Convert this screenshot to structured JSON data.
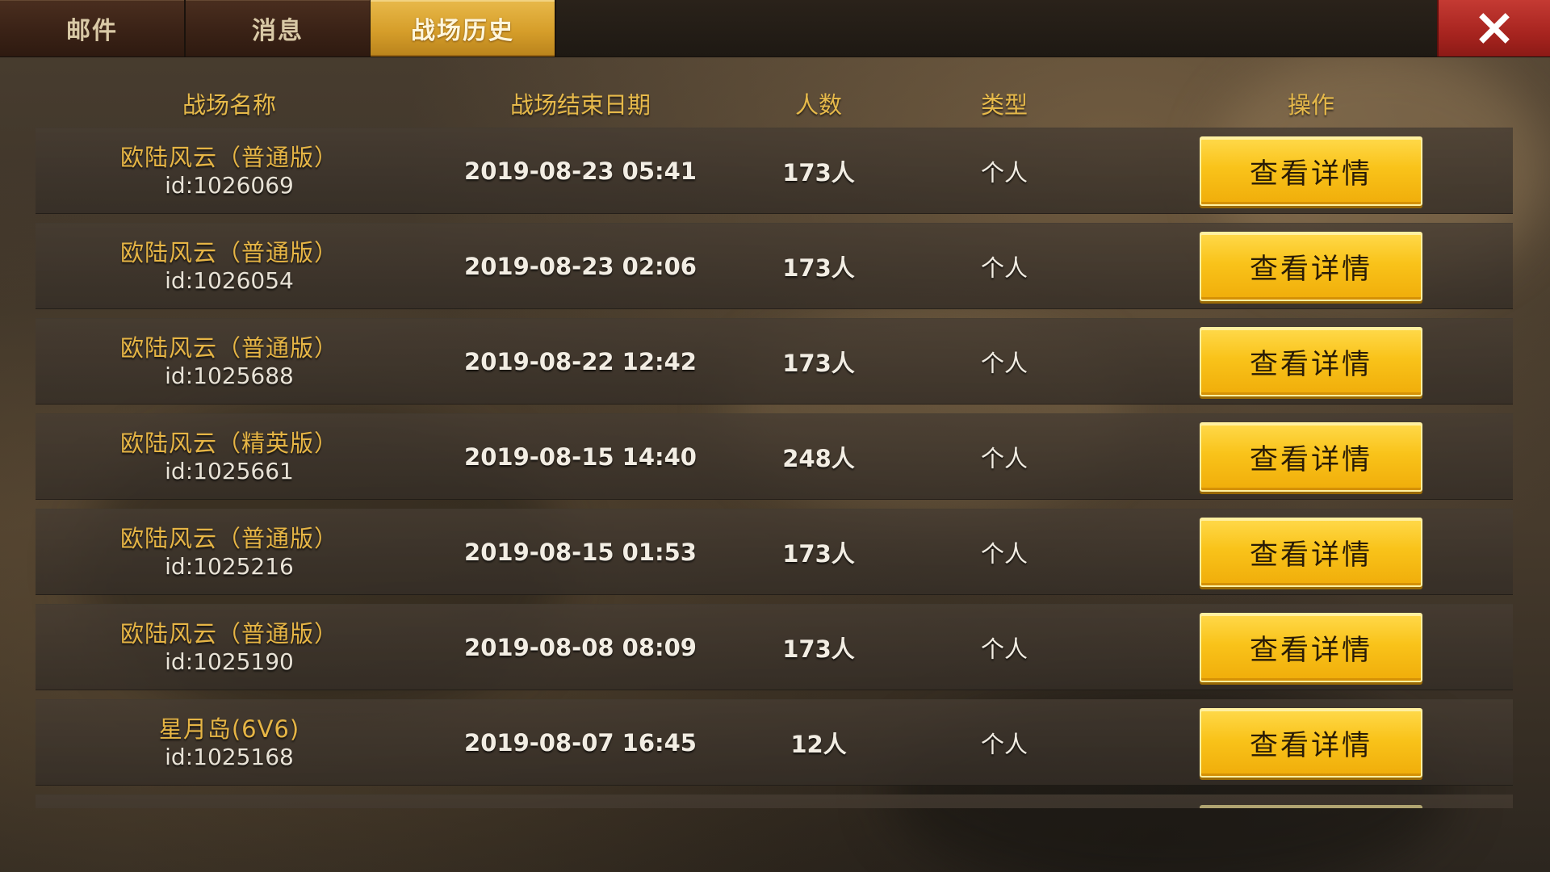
{
  "tabs": [
    {
      "label": "邮件",
      "active": false
    },
    {
      "label": "消息",
      "active": false
    },
    {
      "label": "战场历史",
      "active": true
    }
  ],
  "close_icon": "close-x-icon",
  "table": {
    "headers": {
      "name": "战场名称",
      "date": "战场结束日期",
      "count": "人数",
      "type": "类型",
      "action": "操作"
    },
    "rows": [
      {
        "name": "欧陆风云（普通版）",
        "id": "id:1026069",
        "date": "2019-08-23 05:41",
        "count": "173人",
        "type": "个人",
        "action": "查看详情"
      },
      {
        "name": "欧陆风云（普通版）",
        "id": "id:1026054",
        "date": "2019-08-23 02:06",
        "count": "173人",
        "type": "个人",
        "action": "查看详情"
      },
      {
        "name": "欧陆风云（普通版）",
        "id": "id:1025688",
        "date": "2019-08-22 12:42",
        "count": "173人",
        "type": "个人",
        "action": "查看详情"
      },
      {
        "name": "欧陆风云（精英版）",
        "id": "id:1025661",
        "date": "2019-08-15 14:40",
        "count": "248人",
        "type": "个人",
        "action": "查看详情"
      },
      {
        "name": "欧陆风云（普通版）",
        "id": "id:1025216",
        "date": "2019-08-15 01:53",
        "count": "173人",
        "type": "个人",
        "action": "查看详情"
      },
      {
        "name": "欧陆风云（普通版）",
        "id": "id:1025190",
        "date": "2019-08-08 08:09",
        "count": "173人",
        "type": "个人",
        "action": "查看详情"
      },
      {
        "name": "星月岛(6V6)",
        "id": "id:1025168",
        "date": "2019-08-07 16:45",
        "count": "12人",
        "type": "个人",
        "action": "查看详情"
      }
    ]
  },
  "colors": {
    "accent_gold": "#e6b545",
    "button_yellow": "#f9c31a",
    "close_red": "#b82c26",
    "active_tab": "#d69e2a"
  }
}
